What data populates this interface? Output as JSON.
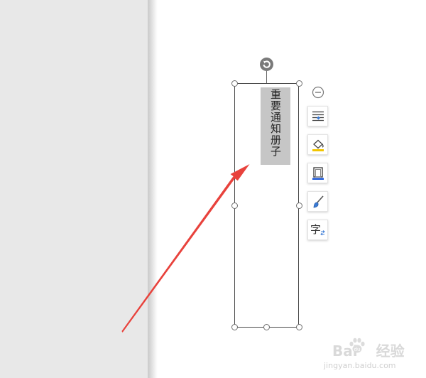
{
  "textbox": {
    "text": "重要通知册子"
  },
  "toolbar": {
    "collapse_icon": "minus-circle-icon",
    "buttons": [
      {
        "id": "layout-options",
        "icon": "text-wrap-icon"
      },
      {
        "id": "fill",
        "icon": "paint-bucket-icon",
        "accent": "#f2c500"
      },
      {
        "id": "outline",
        "icon": "shape-outline-icon",
        "accent": "#1a56d6"
      },
      {
        "id": "format-painter",
        "icon": "brush-icon",
        "accent": "#3a7bd5"
      },
      {
        "id": "text-direction",
        "icon": "text-direction-icon",
        "glyph": "字"
      }
    ]
  },
  "annotation": {
    "arrow_color": "#e8423c"
  },
  "watermark": {
    "line1_left": "Bai",
    "line1_right": "经验",
    "line2": "jingyan.baidu.com"
  }
}
